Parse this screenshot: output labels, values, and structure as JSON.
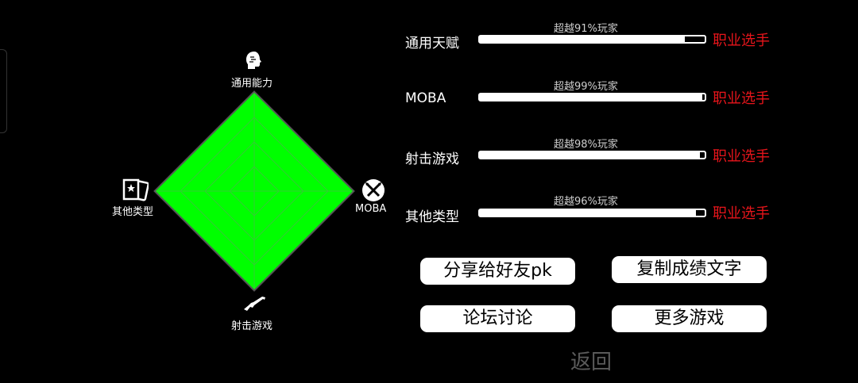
{
  "radar": {
    "axes": [
      {
        "key": "general",
        "label": "通用能力",
        "icon": "head-icon"
      },
      {
        "key": "moba",
        "label": "MOBA",
        "icon": "crossed-swords-icon"
      },
      {
        "key": "shooter",
        "label": "射击游戏",
        "icon": "rifle-icon"
      },
      {
        "key": "other",
        "label": "其他类型",
        "icon": "card-star-icon"
      }
    ],
    "values": [
      1.0,
      1.0,
      1.0,
      1.0
    ],
    "fill_color": "#00ff00",
    "grid_levels": 4
  },
  "stats": [
    {
      "label": "通用天赋",
      "percent_text": "超越91%玩家",
      "fill": 0.91,
      "rank": "职业选手"
    },
    {
      "label": "MOBA",
      "percent_text": "超越99%玩家",
      "fill": 0.99,
      "rank": "职业选手"
    },
    {
      "label": "射击游戏",
      "percent_text": "超越98%玩家",
      "fill": 0.98,
      "rank": "职业选手"
    },
    {
      "label": "其他类型",
      "percent_text": "超越96%玩家",
      "fill": 0.96,
      "rank": "职业选手"
    }
  ],
  "buttons": {
    "share": "分享给好友pk",
    "copy": "复制成绩文字",
    "forum": "论坛讨论",
    "more_games": "更多游戏"
  },
  "back_label": "返回",
  "colors": {
    "rank": "#e8151b",
    "radar_fill": "#00ff00",
    "background": "#000000"
  }
}
